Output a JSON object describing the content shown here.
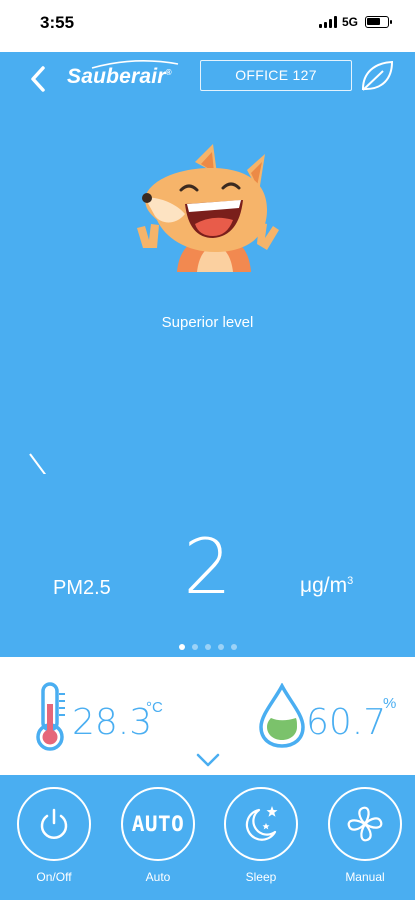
{
  "status_bar": {
    "time": "3:55",
    "network": "5G"
  },
  "header": {
    "brand": "Sauberair",
    "brand_mark": "®",
    "device_name": "OFFICE 127"
  },
  "air_quality": {
    "level_label": "Superior level",
    "pm_label": "PM2.5",
    "pm_value": "2",
    "pm_unit": "μg/m",
    "pm_unit_sup": "3"
  },
  "pager": {
    "pages": 5,
    "active": 0
  },
  "readings": {
    "temperature": "28.3",
    "temperature_unit": "°C",
    "humidity": "60.7",
    "humidity_unit": "%"
  },
  "controls": [
    {
      "label": "On/Off",
      "icon": "power-icon"
    },
    {
      "label": "Auto",
      "icon": "auto-text",
      "text": "AUTO"
    },
    {
      "label": "Sleep",
      "icon": "moon-stars-icon"
    },
    {
      "label": "Manual",
      "icon": "fan-icon"
    }
  ],
  "colors": {
    "primary": "#4aaef1",
    "white": "#ffffff",
    "thermo": "#e5677a",
    "droplet": "#7bc26b"
  }
}
